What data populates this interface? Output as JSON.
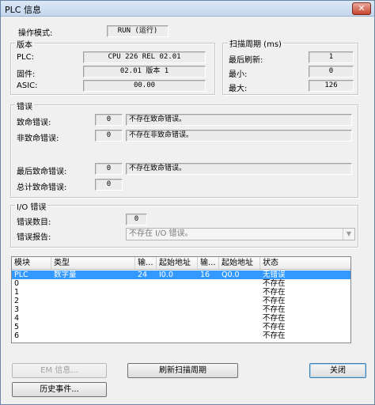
{
  "window": {
    "title": "PLC 信息",
    "close_glyph": "✕"
  },
  "op_mode": {
    "label": "操作模式:",
    "value": "RUN (运行)"
  },
  "version": {
    "title": "版本",
    "plc_label": "PLC:",
    "plc_value": "CPU 226 REL 02.01",
    "firmware_label": "固件:",
    "firmware_value": "02.01 版本 1",
    "asic_label": "ASIC:",
    "asic_value": "00.00"
  },
  "scan": {
    "title": "扫描周期 (ms)",
    "last_label": "最后刷新:",
    "last_value": "1",
    "min_label": "最小:",
    "min_value": "0",
    "max_label": "最大:",
    "max_value": "126"
  },
  "errors": {
    "title": "错误",
    "fatal_label": "致命错误:",
    "fatal_code": "0",
    "fatal_text": "不存在致命错误。",
    "nonfatal_label": "非致命错误:",
    "nonfatal_code": "0",
    "nonfatal_text": "不存在非致命错误。",
    "last_fatal_label": "最后致命错误:",
    "last_fatal_code": "0",
    "last_fatal_text": "不存在致命错误。",
    "total_fatal_label": "总计致命错误:",
    "total_fatal_code": "0"
  },
  "io_errors": {
    "title": "I/O 错误",
    "count_label": "错误数目:",
    "count_value": "0",
    "report_label": "错误报告:",
    "report_value": "不存在 I/O 错误。"
  },
  "modules_table": {
    "headers": [
      "模块",
      "类型",
      "输...",
      "起始地址",
      "输...",
      "起始地址",
      "状态"
    ],
    "rows": [
      [
        "PLC",
        "数字量",
        "24",
        "I0.0",
        "16",
        "Q0.0",
        "无错误"
      ],
      [
        "0",
        "",
        "",
        "",
        "",
        "",
        "不存在"
      ],
      [
        "1",
        "",
        "",
        "",
        "",
        "",
        "不存在"
      ],
      [
        "2",
        "",
        "",
        "",
        "",
        "",
        "不存在"
      ],
      [
        "3",
        "",
        "",
        "",
        "",
        "",
        "不存在"
      ],
      [
        "4",
        "",
        "",
        "",
        "",
        "",
        "不存在"
      ],
      [
        "5",
        "",
        "",
        "",
        "",
        "",
        "不存在"
      ],
      [
        "6",
        "",
        "",
        "",
        "",
        "",
        "不存在"
      ]
    ]
  },
  "buttons": {
    "em_info": "EM 信息...",
    "refresh_scan": "刷新扫描周期",
    "close": "关闭",
    "history": "历史事件..."
  }
}
